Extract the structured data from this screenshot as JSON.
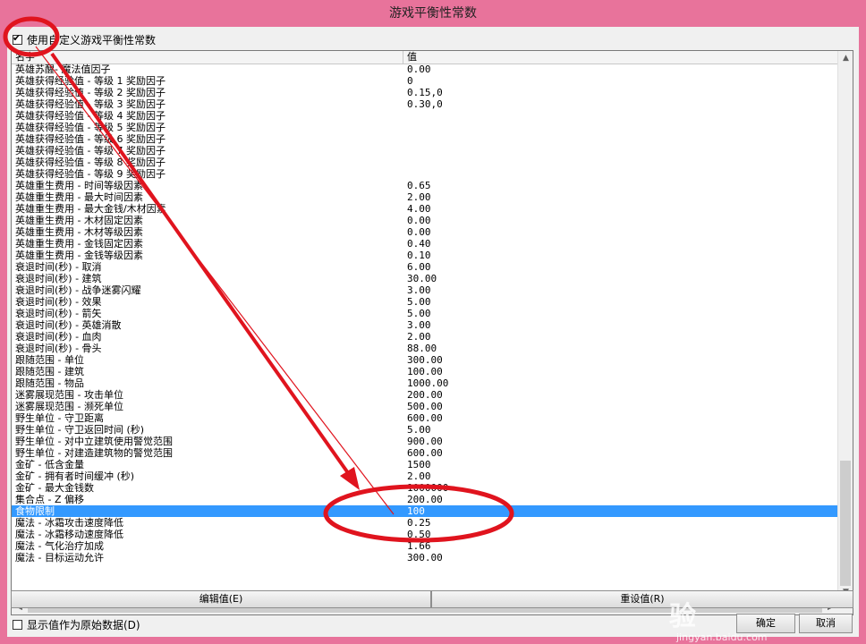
{
  "window": {
    "title": "游戏平衡性常数"
  },
  "use_custom": {
    "label": "使用自定义游戏平衡性常数",
    "checked": true
  },
  "table": {
    "columns": [
      "名字",
      "值"
    ],
    "selected_index": 38,
    "rows": [
      {
        "name": "英雄苏醒- 魔法值因子",
        "value": "0.00"
      },
      {
        "name": "英雄获得经验值 - 等级 1 奖励因子",
        "value": "0"
      },
      {
        "name": "英雄获得经验值 - 等级 2 奖励因子",
        "value": "0.15,0"
      },
      {
        "name": "英雄获得经验值 - 等级 3 奖励因子",
        "value": "0.30,0"
      },
      {
        "name": "英雄获得经验值 - 等级 4 奖励因子",
        "value": ""
      },
      {
        "name": "英雄获得经验值 - 等级 5 奖励因子",
        "value": ""
      },
      {
        "name": "英雄获得经验值 - 等级 6 奖励因子",
        "value": ""
      },
      {
        "name": "英雄获得经验值 - 等级 7 奖励因子",
        "value": ""
      },
      {
        "name": "英雄获得经验值 - 等级 8 奖励因子",
        "value": ""
      },
      {
        "name": "英雄获得经验值 - 等级 9 奖励因子",
        "value": ""
      },
      {
        "name": "英雄重生费用 - 时间等级因素",
        "value": "0.65"
      },
      {
        "name": "英雄重生费用 - 最大时间因素",
        "value": "2.00"
      },
      {
        "name": "英雄重生费用 - 最大金钱/木材因素",
        "value": "4.00"
      },
      {
        "name": "英雄重生费用 - 木材固定因素",
        "value": "0.00"
      },
      {
        "name": "英雄重生费用 - 木材等级因素",
        "value": "0.00"
      },
      {
        "name": "英雄重生费用 - 金钱固定因素",
        "value": "0.40"
      },
      {
        "name": "英雄重生费用 - 金钱等级因素",
        "value": "0.10"
      },
      {
        "name": "衰退时间(秒) - 取消",
        "value": "6.00"
      },
      {
        "name": "衰退时间(秒) - 建筑",
        "value": "30.00"
      },
      {
        "name": "衰退时间(秒) - 战争迷雾闪耀",
        "value": "3.00"
      },
      {
        "name": "衰退时间(秒) - 效果",
        "value": "5.00"
      },
      {
        "name": "衰退时间(秒) - 箭矢",
        "value": "5.00"
      },
      {
        "name": "衰退时间(秒) - 英雄消散",
        "value": "3.00"
      },
      {
        "name": "衰退时间(秒) - 血肉",
        "value": "2.00"
      },
      {
        "name": "衰退时间(秒) - 骨头",
        "value": "88.00"
      },
      {
        "name": "跟随范围 - 单位",
        "value": "300.00"
      },
      {
        "name": "跟随范围 - 建筑",
        "value": "100.00"
      },
      {
        "name": "跟随范围 - 物品",
        "value": "1000.00"
      },
      {
        "name": "迷雾展现范围 - 攻击单位",
        "value": "200.00"
      },
      {
        "name": "迷雾展现范围 - 濒死单位",
        "value": "500.00"
      },
      {
        "name": "野生单位 - 守卫距离",
        "value": "600.00"
      },
      {
        "name": "野生单位 - 守卫返回时间 (秒)",
        "value": "5.00"
      },
      {
        "name": "野生单位 - 对中立建筑使用警觉范围",
        "value": "900.00"
      },
      {
        "name": "野生单位 - 对建造建筑物的警觉范围",
        "value": "600.00"
      },
      {
        "name": "金矿 - 低含金量",
        "value": "1500"
      },
      {
        "name": "金矿 - 拥有者时间缓冲 (秒)",
        "value": "2.00"
      },
      {
        "name": "金矿 - 最大金钱数",
        "value": "1000000"
      },
      {
        "name": "集合点 - Z 偏移",
        "value": "200.00"
      },
      {
        "name": "食物限制",
        "value": "100"
      },
      {
        "name": "魔法 - 冰霜攻击速度降低",
        "value": "0.25"
      },
      {
        "name": "魔法 - 冰霜移动速度降低",
        "value": "0.50"
      },
      {
        "name": "魔法 - 气化治疗加成",
        "value": "1.66"
      },
      {
        "name": "魔法 - 目标运动允许",
        "value": "300.00"
      }
    ]
  },
  "buttons": {
    "edit": "编辑值(E)",
    "reset": "重设值(R)",
    "ok": "确定",
    "cancel": "取消"
  },
  "show_raw": {
    "label": "显示值作为原始数据(D)",
    "checked": false
  },
  "watermark": {
    "logo": "Bai百度经验",
    "url": "jingyan.baidu.com"
  },
  "annotation": {
    "color": "#e0141e"
  }
}
